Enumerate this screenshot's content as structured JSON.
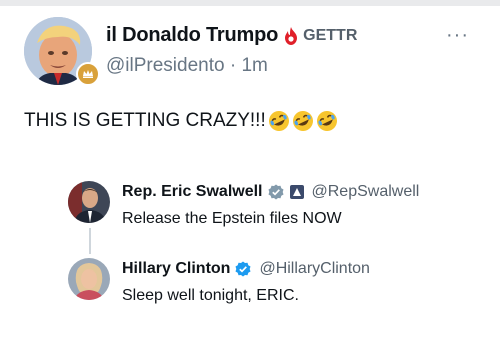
{
  "post": {
    "display_name": "il Donaldo Trumpo",
    "platform_label": "GETTR",
    "handle": "@ilPresidento",
    "separator": "·",
    "time": "1m",
    "text": "THIS IS GETTING CRAZY!!!",
    "more_label": "···",
    "emoji_count": 3
  },
  "thread": [
    {
      "name": "Rep. Eric Swalwell",
      "handle": "@RepSwalwell",
      "text": "Release the Epstein files NOW"
    },
    {
      "name": "Hillary Clinton",
      "handle": "@HillaryClinton",
      "text": "Sleep well tonight, ERIC."
    }
  ],
  "colors": {
    "verified": "#1d9bf0",
    "gettr": "#e0202a",
    "text": "#0f1419",
    "muted": "#687684"
  }
}
